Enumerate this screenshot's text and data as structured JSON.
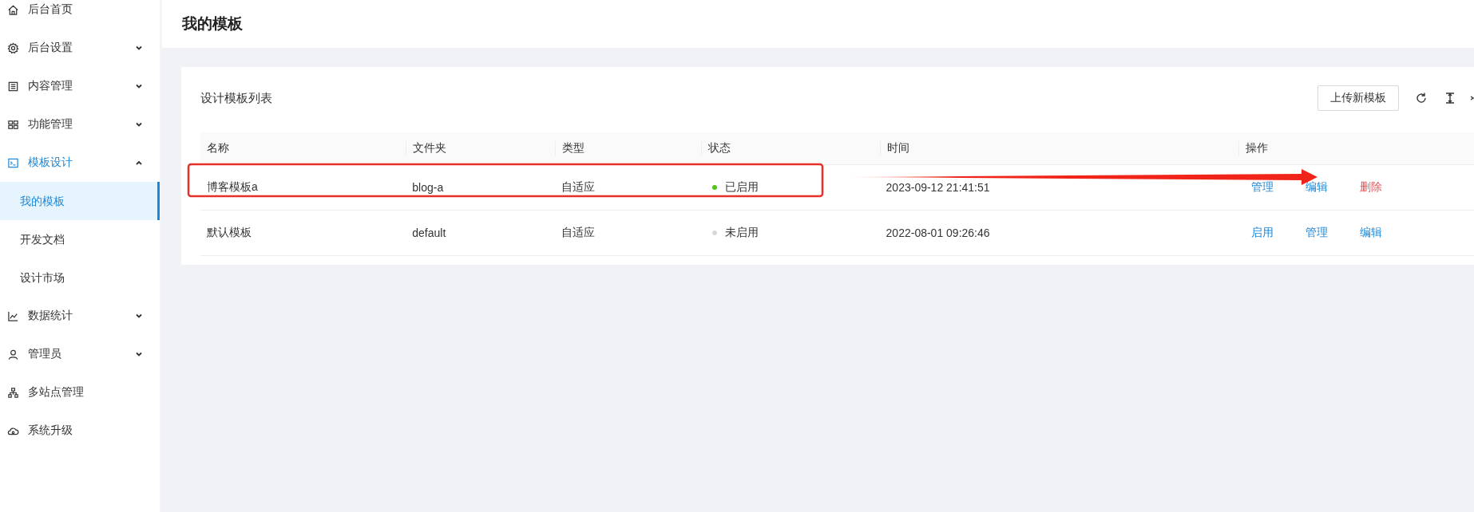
{
  "sidebar": {
    "items": [
      {
        "label": "后台首页",
        "kind": "link",
        "selected": false
      },
      {
        "label": "后台设置",
        "kind": "group",
        "selected": false,
        "expanded": false
      },
      {
        "label": "内容管理",
        "kind": "group",
        "selected": false,
        "expanded": false
      },
      {
        "label": "功能管理",
        "kind": "group",
        "selected": false,
        "expanded": false
      },
      {
        "label": "模板设计",
        "kind": "group",
        "selected": true,
        "expanded": true,
        "children": [
          {
            "label": "我的模板",
            "selected": true
          },
          {
            "label": "开发文档",
            "selected": false
          },
          {
            "label": "设计市场",
            "selected": false
          }
        ]
      },
      {
        "label": "数据统计",
        "kind": "group",
        "selected": false,
        "expanded": false
      },
      {
        "label": "管理员",
        "kind": "group",
        "selected": false,
        "expanded": false
      },
      {
        "label": "多站点管理",
        "kind": "link",
        "selected": false
      },
      {
        "label": "系统升级",
        "kind": "link",
        "selected": false
      }
    ]
  },
  "page": {
    "title": "我的模板"
  },
  "card": {
    "title": "设计模板列表",
    "upload_button": "上传新模板"
  },
  "table": {
    "columns": [
      "名称",
      "文件夹",
      "类型",
      "状态",
      "时间",
      "操作"
    ],
    "rows": [
      {
        "name": "博客模板a",
        "folder": "blog-a",
        "type": "自适应",
        "status": "已启用",
        "enabled": true,
        "time": "2023-09-12 21:41:51",
        "actions": [
          {
            "label": "管理",
            "kind": "link"
          },
          {
            "label": "编辑",
            "kind": "link"
          },
          {
            "label": "删除",
            "kind": "danger"
          }
        ]
      },
      {
        "name": "默认模板",
        "folder": "default",
        "type": "自适应",
        "status": "未启用",
        "enabled": false,
        "time": "2022-08-01 09:26:46",
        "actions": [
          {
            "label": "启用",
            "kind": "link"
          },
          {
            "label": "管理",
            "kind": "link"
          },
          {
            "label": "编辑",
            "kind": "link"
          }
        ]
      }
    ]
  }
}
